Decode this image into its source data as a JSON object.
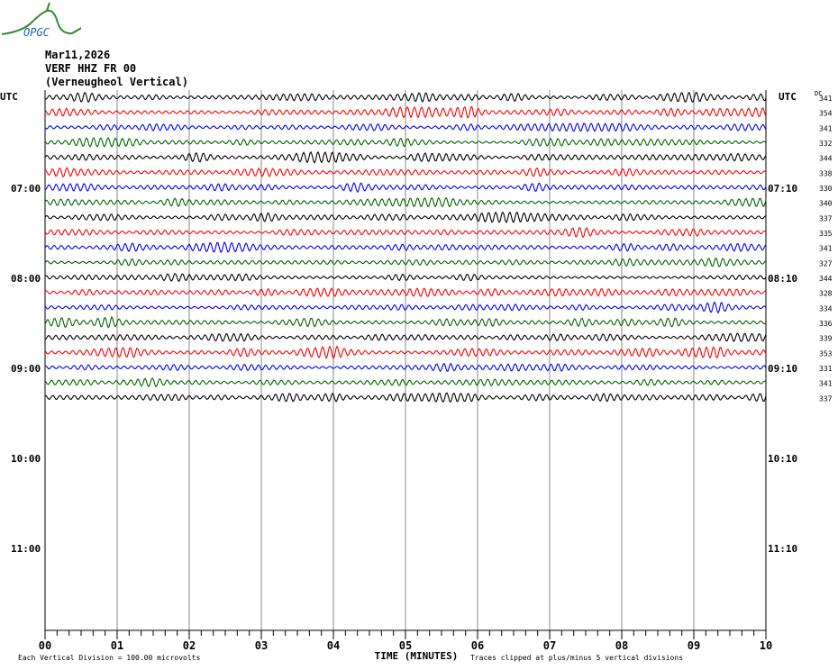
{
  "logo_text": "OPGC",
  "header": {
    "date": "Mar11,2026",
    "channel": "VERF HHZ FR 00",
    "station": "(Verneugheol Vertical)"
  },
  "chart_data": {
    "type": "line",
    "title": "Mar11,2026 VERF HHZ FR 00 (Verneugheol Vertical)",
    "xlabel": "TIME (MINUTES)",
    "xlim": [
      0,
      10
    ],
    "x_ticks": [
      "00",
      "01",
      "02",
      "03",
      "04",
      "05",
      "06",
      "07",
      "08",
      "09",
      "10"
    ],
    "left_axis_title": "UTC",
    "right_axis_title": "UTC",
    "dc_title": "DC",
    "left_hour_labels": [
      "07:00",
      "08:00",
      "09:00",
      "10:00",
      "11:00"
    ],
    "right_hour_labels": [
      "07:10",
      "08:10",
      "09:10",
      "10:10",
      "11:10"
    ],
    "rows_per_hour": 6,
    "total_rows": 36,
    "trace_colors": [
      "#000000",
      "#ff0000",
      "#0000ff",
      "#006400"
    ],
    "dc_offsets": [
      341,
      354,
      341,
      332,
      344,
      338,
      330,
      340,
      337,
      335,
      341,
      327,
      344,
      328,
      334,
      336,
      339,
      353,
      331,
      341,
      337
    ],
    "footer_left": "Each Vertical Division =  100.00 microvolts",
    "footer_right": "Traces clipped at plus/minus 5 vertical divisions"
  }
}
